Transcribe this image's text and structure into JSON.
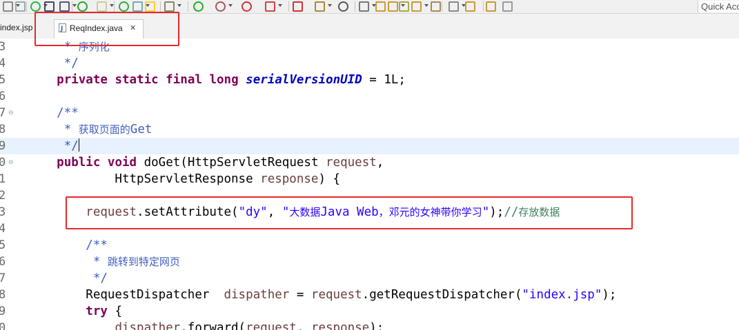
{
  "toolbar": {
    "quick_access": "Quick Acc",
    "icons": [
      "file-icon",
      "copy-icon",
      "run-config-icon",
      "screen-icon",
      "pin-icon",
      "power-icon",
      "book-icon",
      "refresh-icon",
      "cursor-icon",
      "highlight-icon",
      "bug-icon",
      "play-icon",
      "debug-run-icon",
      "coverage-icon",
      "stop-icon",
      "tool-icon",
      "package-icon",
      "gear-icon",
      "java-perspective-icon",
      "open-folder-icon",
      "folder-icon",
      "pen-icon",
      "folder-open-icon",
      "annotation-icon",
      "next-icon",
      "back-icon",
      "forward-icon",
      "home-icon"
    ]
  },
  "tabs": [
    {
      "label": "index.jsp",
      "active": false
    },
    {
      "label": "ReqIndex.java",
      "active": true,
      "close": "✕"
    }
  ],
  "editor": {
    "lines": [
      {
        "num": "3",
        "tokens": [
          {
            "t": "     ",
            "c": ""
          },
          {
            "t": "* ",
            "c": "cm"
          },
          {
            "t": "序列化",
            "c": "cmcn"
          }
        ]
      },
      {
        "num": "4",
        "tokens": [
          {
            "t": "     */",
            "c": "cm"
          }
        ]
      },
      {
        "num": "5",
        "tokens": [
          {
            "t": "    ",
            "c": ""
          },
          {
            "t": "private",
            "c": "kw"
          },
          {
            "t": " ",
            "c": ""
          },
          {
            "t": "static",
            "c": "kw"
          },
          {
            "t": " ",
            "c": ""
          },
          {
            "t": "final",
            "c": "kw"
          },
          {
            "t": " ",
            "c": ""
          },
          {
            "t": "long",
            "c": "kw"
          },
          {
            "t": " ",
            "c": ""
          },
          {
            "t": "serialVersionUID",
            "c": "fs"
          },
          {
            "t": " = 1L;",
            "c": ""
          }
        ]
      },
      {
        "num": "6",
        "tokens": []
      },
      {
        "num": "7",
        "fold": true,
        "tokens": [
          {
            "t": "    /**",
            "c": "cm"
          }
        ]
      },
      {
        "num": "8",
        "tokens": [
          {
            "t": "     ",
            "c": ""
          },
          {
            "t": "* ",
            "c": "cm"
          },
          {
            "t": "获取页面的",
            "c": "cmcn"
          },
          {
            "t": "Get",
            "c": "cmbl"
          }
        ]
      },
      {
        "num": "9",
        "current": true,
        "tokens": [
          {
            "t": "     */",
            "c": "cm"
          }
        ]
      },
      {
        "num": "0",
        "fold": true,
        "tokens": [
          {
            "t": "    ",
            "c": ""
          },
          {
            "t": "public",
            "c": "kw"
          },
          {
            "t": " ",
            "c": ""
          },
          {
            "t": "void",
            "c": "kw"
          },
          {
            "t": " doGet(HttpServletRequest ",
            "c": ""
          },
          {
            "t": "request",
            "c": "lv"
          },
          {
            "t": ",",
            "c": ""
          }
        ]
      },
      {
        "num": "1",
        "tokens": [
          {
            "t": "            HttpServletResponse ",
            "c": ""
          },
          {
            "t": "response",
            "c": "lv"
          },
          {
            "t": ") {",
            "c": ""
          }
        ]
      },
      {
        "num": "2",
        "tokens": []
      },
      {
        "num": "3",
        "tokens": [
          {
            "t": "        ",
            "c": ""
          },
          {
            "t": "request",
            "c": "lv"
          },
          {
            "t": ".setAttribute(",
            "c": ""
          },
          {
            "t": "\"dy\"",
            "c": "st"
          },
          {
            "t": ", ",
            "c": ""
          },
          {
            "t": "\"",
            "c": "st"
          },
          {
            "t": "大数据",
            "c": "stcn"
          },
          {
            "t": "Java Web",
            "c": "st"
          },
          {
            "t": "，邓元的女神带你学习",
            "c": "stcn"
          },
          {
            "t": "\"",
            "c": "st"
          },
          {
            "t": ");",
            "c": ""
          },
          {
            "t": "//",
            "c": "slc"
          },
          {
            "t": "存放数据",
            "c": "slccn"
          }
        ]
      },
      {
        "num": "4",
        "tokens": []
      },
      {
        "num": "5",
        "tokens": [
          {
            "t": "        /**",
            "c": "cm"
          }
        ]
      },
      {
        "num": "6",
        "tokens": [
          {
            "t": "         ",
            "c": ""
          },
          {
            "t": "* ",
            "c": "cm"
          },
          {
            "t": "跳转到特定网页",
            "c": "cmcn"
          }
        ]
      },
      {
        "num": "7",
        "tokens": [
          {
            "t": "         */",
            "c": "cm"
          }
        ]
      },
      {
        "num": "8",
        "tokens": [
          {
            "t": "        RequestDispatcher  ",
            "c": ""
          },
          {
            "t": "dispather",
            "c": "lv"
          },
          {
            "t": " = ",
            "c": ""
          },
          {
            "t": "request",
            "c": "lv"
          },
          {
            "t": ".getRequestDispatcher(",
            "c": ""
          },
          {
            "t": "\"index.jsp\"",
            "c": "st"
          },
          {
            "t": ");",
            "c": ""
          }
        ]
      },
      {
        "num": "9",
        "tokens": [
          {
            "t": "        ",
            "c": ""
          },
          {
            "t": "try",
            "c": "kw"
          },
          {
            "t": " {",
            "c": ""
          }
        ]
      },
      {
        "num": "0",
        "tokens": [
          {
            "t": "            ",
            "c": ""
          },
          {
            "t": "dispather",
            "c": "lv"
          },
          {
            "t": ".forward(",
            "c": ""
          },
          {
            "t": "request",
            "c": "lv"
          },
          {
            "t": ", ",
            "c": ""
          },
          {
            "t": "response",
            "c": "lv"
          },
          {
            "t": ");",
            "c": ""
          }
        ]
      }
    ]
  },
  "colors": {
    "keyword": "#7f0055",
    "comment": "#3f5fbf",
    "string": "#2a00ff",
    "line_comment": "#3f7f5f",
    "field": "#0000c0",
    "local_var": "#6a3e3e",
    "current_line": "#e8f2fe",
    "highlight_box": "#e8262b"
  }
}
